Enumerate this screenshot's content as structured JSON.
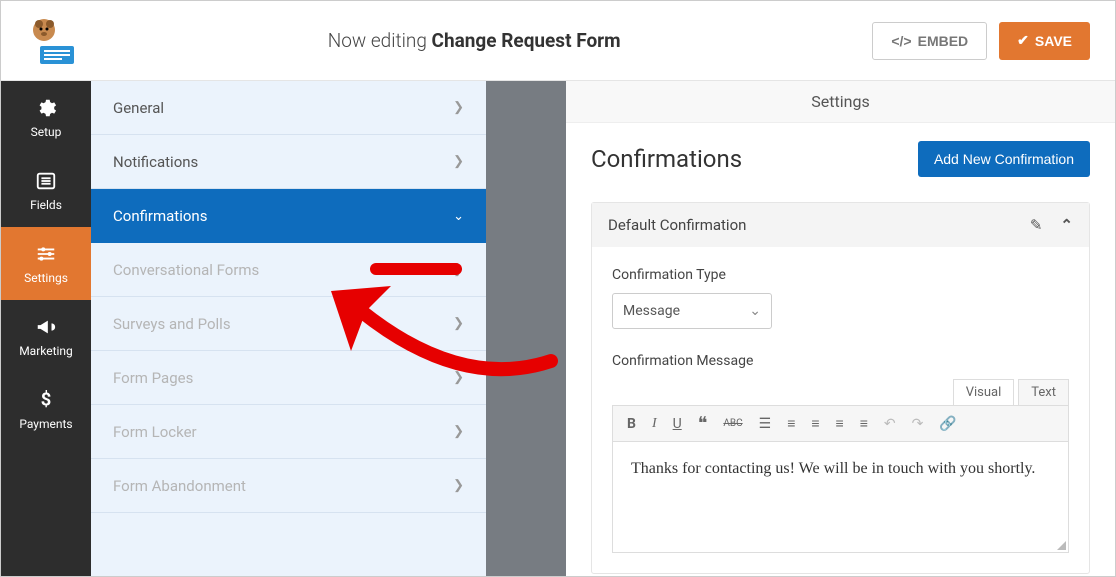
{
  "topbar": {
    "editing_prefix": "Now editing ",
    "form_name": "Change Request Form",
    "embed_label": "EMBED",
    "save_label": "SAVE"
  },
  "icon_nav": [
    {
      "label": "Setup",
      "icon": "gear"
    },
    {
      "label": "Fields",
      "icon": "list"
    },
    {
      "label": "Settings",
      "icon": "sliders",
      "active": true
    },
    {
      "label": "Marketing",
      "icon": "bullhorn"
    },
    {
      "label": "Payments",
      "icon": "dollar"
    }
  ],
  "second_nav": [
    {
      "label": "General"
    },
    {
      "label": "Notifications"
    },
    {
      "label": "Confirmations",
      "active": true
    },
    {
      "label": "Conversational Forms",
      "dim": true
    },
    {
      "label": "Surveys and Polls",
      "dim": true
    },
    {
      "label": "Form Pages",
      "dim": true
    },
    {
      "label": "Form Locker",
      "dim": true
    },
    {
      "label": "Form Abandonment",
      "dim": true
    }
  ],
  "main": {
    "settings_header": "Settings",
    "page_title": "Confirmations",
    "add_button": "Add New Confirmation",
    "panel_title": "Default Confirmation",
    "type_label": "Confirmation Type",
    "type_value": "Message",
    "message_label": "Confirmation Message",
    "tabs": {
      "visual": "Visual",
      "text": "Text"
    },
    "editor_content": "Thanks for contacting us! We will be in touch with you shortly."
  }
}
